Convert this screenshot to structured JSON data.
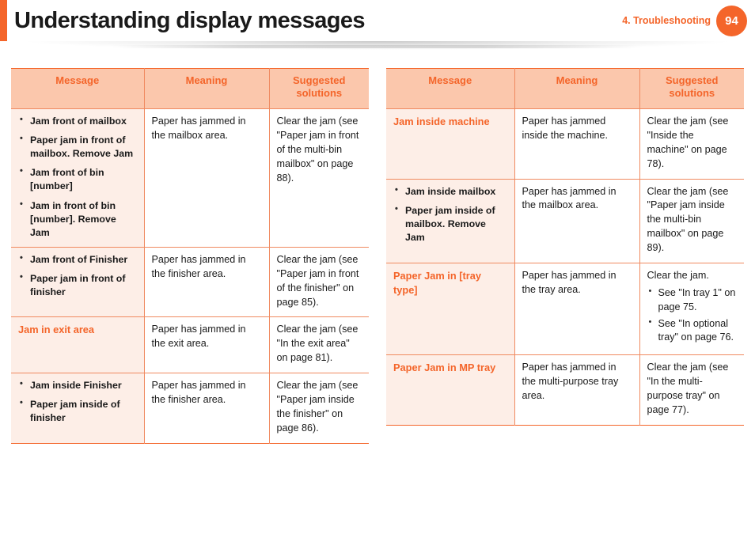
{
  "header": {
    "title": "Understanding display messages",
    "chapter_label": "4.  Troubleshooting",
    "page_number": "94",
    "accent_color": "#f4652a"
  },
  "tables": {
    "columns": [
      "Message",
      "Meaning",
      "Suggested solutions"
    ],
    "left": {
      "headers": {
        "message": "Message",
        "meaning": "Meaning",
        "solutions": "Suggested solutions"
      },
      "rows": [
        {
          "message_items": [
            "Jam front of mailbox",
            "Paper jam in front of mailbox. Remove Jam",
            "Jam front of bin [number]",
            "Jam in front of bin [number]. Remove Jam"
          ],
          "meaning": "Paper has jammed in the mailbox area.",
          "solution": "Clear the jam (see \"Paper jam in front of the multi-bin mailbox\" on page 88)."
        },
        {
          "message_items": [
            "Jam front of Finisher",
            "Paper jam in front of finisher"
          ],
          "meaning": "Paper has jammed in the finisher area.",
          "solution": "Clear the jam (see \"Paper jam in front of the finisher\" on page 85)."
        },
        {
          "message_plain": "Jam in exit area",
          "meaning": "Paper has jammed in the exit area.",
          "solution": "Clear the jam (see \"In the exit area\" on page 81)."
        },
        {
          "message_items": [
            "Jam inside Finisher",
            "Paper jam inside of finisher"
          ],
          "meaning": "Paper has jammed in the finisher area.",
          "solution": "Clear the jam (see \"Paper jam inside the finisher\" on page 86)."
        }
      ]
    },
    "right": {
      "headers": {
        "message": "Message",
        "meaning": "Meaning",
        "solutions": "Suggested solutions"
      },
      "rows": [
        {
          "message_plain": "Jam inside machine",
          "meaning": "Paper has jammed inside the machine.",
          "solution": "Clear the jam (see \"Inside the machine\" on page 78)."
        },
        {
          "message_items": [
            "Jam inside mailbox",
            "Paper jam inside of mailbox. Remove Jam"
          ],
          "meaning": "Paper has jammed in the mailbox area.",
          "solution": "Clear the jam (see \"Paper jam inside the multi-bin mailbox\" on page 89)."
        },
        {
          "message_plain": "Paper Jam in [tray type]",
          "meaning": "Paper has jammed in the tray area.",
          "solution_lead": "Clear the jam.",
          "solution_items": [
            "See \"In tray 1\" on page 75.",
            "See \"In optional tray\" on page 76."
          ]
        },
        {
          "message_plain": "Paper Jam in MP tray",
          "meaning": "Paper has jammed in the multi-purpose tray area.",
          "solution": "Clear the jam (see \"In the multi-purpose tray\" on page 77)."
        }
      ]
    }
  }
}
